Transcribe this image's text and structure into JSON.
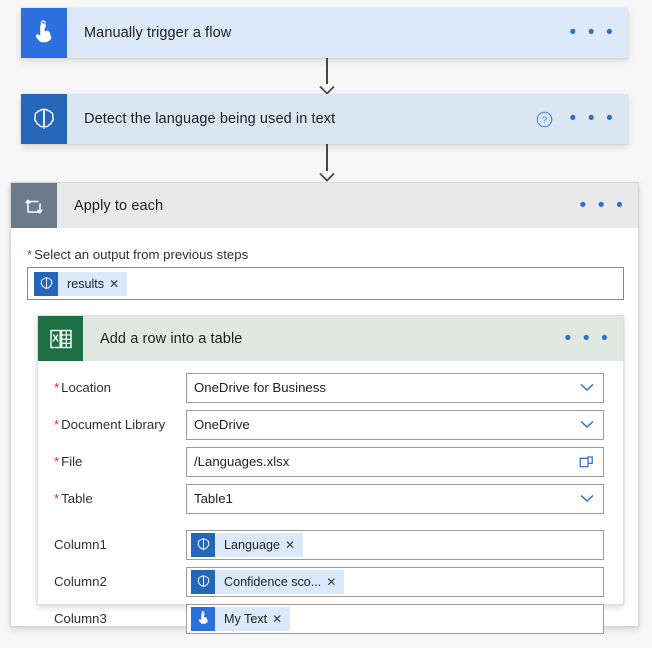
{
  "flow": {
    "trigger": {
      "title": "Manually trigger a flow",
      "icon": "tap-hand-icon",
      "menu_label": "• • •",
      "header_color": "#dce9f9",
      "icon_color": "#2e6fe0"
    },
    "detect_action": {
      "title": "Detect the language being used in text",
      "icon": "brain-icon",
      "help_label": "?",
      "menu_label": "• • •",
      "header_color": "#dae7f2",
      "icon_color": "#2566b8"
    },
    "apply_to_each": {
      "title": "Apply to each",
      "icon": "loop-icon",
      "menu_label": "• • •",
      "header_color": "#e9e9e9",
      "icon_color": "#6c7b8c",
      "select_output": {
        "label": "Select an output from previous steps",
        "required_marker": "*",
        "token": {
          "label": "results",
          "icon": "brain-icon",
          "remove_label": "✕"
        }
      },
      "excel_action": {
        "title": "Add a row into a table",
        "icon": "excel-icon",
        "menu_label": "• • •",
        "header_color": "#dfe9e1",
        "icon_color": "#1d7044",
        "fields": [
          {
            "label": "Location",
            "required": true,
            "required_marker": "*",
            "value": "OneDrive for Business",
            "control": "dropdown",
            "affordance_icon": "chevron-down-icon"
          },
          {
            "label": "Document Library",
            "required": true,
            "required_marker": "*",
            "value": "OneDrive",
            "control": "dropdown",
            "affordance_icon": "chevron-down-icon"
          },
          {
            "label": "File",
            "required": true,
            "required_marker": "*",
            "value": "/Languages.xlsx",
            "control": "file-picker",
            "affordance_icon": "folder-icon"
          },
          {
            "label": "Table",
            "required": true,
            "required_marker": "*",
            "value": "Table1",
            "control": "dropdown",
            "affordance_icon": "chevron-down-icon"
          }
        ],
        "columns": [
          {
            "label": "Column1",
            "required": false,
            "token": {
              "label": "Language",
              "icon": "brain-icon",
              "remove_label": "✕"
            }
          },
          {
            "label": "Column2",
            "required": false,
            "token": {
              "label": "Confidence sco...",
              "icon": "brain-icon",
              "remove_label": "✕"
            }
          },
          {
            "label": "Column3",
            "required": false,
            "token": {
              "label": "My Text",
              "icon": "tap-hand-icon",
              "remove_label": "✕"
            }
          }
        ]
      }
    }
  }
}
